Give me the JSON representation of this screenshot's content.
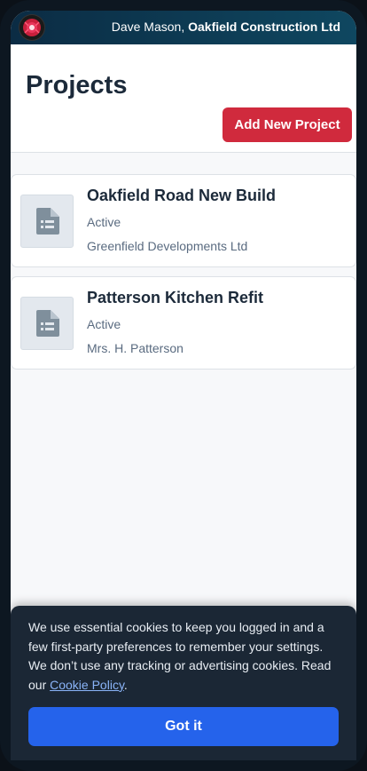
{
  "topbar": {
    "user_name": "Dave Mason,",
    "company": "Oakfield Construction Ltd",
    "logo_icon": "brand-logo-icon"
  },
  "page": {
    "title": "Projects",
    "add_button_label": "Add New Project"
  },
  "projects": [
    {
      "title": "Oakfield Road New Build",
      "status": "Active",
      "client": "Greenfield Developments Ltd",
      "icon": "document-icon"
    },
    {
      "title": "Patterson Kitchen Refit",
      "status": "Active",
      "client": "Mrs. H. Patterson",
      "icon": "document-icon"
    }
  ],
  "cookie_banner": {
    "text": "We use essential cookies to keep you logged in and a few first-party preferences to remember your settings. We don’t use any tracking or advertising cookies. Read our ",
    "link_label": "Cookie Policy",
    "text_end": ".",
    "button_label": "Got it"
  },
  "colors": {
    "accent_red": "#d02a3d",
    "primary_blue": "#2563eb",
    "topbar_dark": "#0b2c44"
  }
}
